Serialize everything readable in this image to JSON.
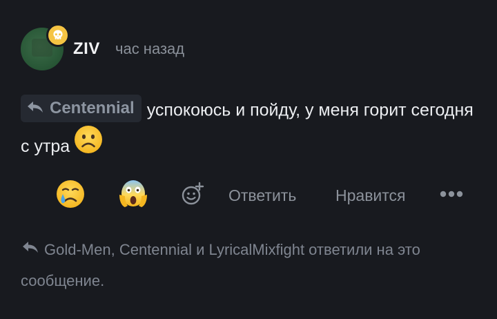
{
  "comment": {
    "author": "ZIV",
    "timestamp": "час назад",
    "reply_to": "Centennial",
    "text": "успокоюсь и пойду, у меня горит сегодня с утра"
  },
  "reactions": [
    {
      "icon": "crying-face-icon"
    },
    {
      "icon": "screaming-face-icon"
    },
    {
      "icon": "add-reaction-icon"
    }
  ],
  "actions": {
    "reply_label": "Ответить",
    "like_label": "Нравится",
    "more_icon": "more-dots-icon"
  },
  "replies_note": {
    "text": "Gold-Men, Centennial и LyricalMixfight ответили на это сообщение."
  },
  "colors": {
    "background": "#181a1f",
    "badge": "#f5c443",
    "muted_text": "#8c929b",
    "chip_bg": "#252931"
  }
}
